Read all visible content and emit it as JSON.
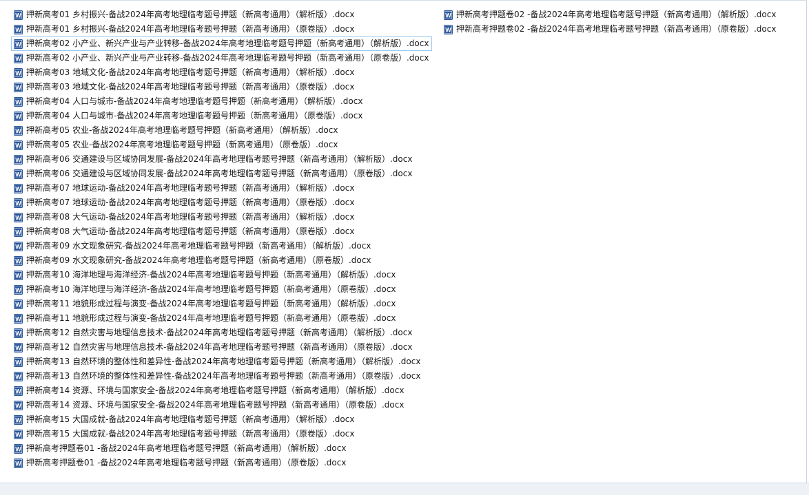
{
  "file_list": {
    "icon": "word-document-icon",
    "icon_color": "#2b579a",
    "selected_index": 2,
    "column_1": [
      "押新高考01 乡村振兴-备战2024年高考地理临考题号押题（新高考通用）（解析版）.docx",
      "押新高考01 乡村振兴-备战2024年高考地理临考题号押题（新高考通用）（原卷版）.docx",
      "押新高考02 小产业、新兴产业与产业转移-备战2024年高考地理临考题号押题（新高考通用）（解析版）.docx",
      "押新高考02 小产业、新兴产业与产业转移-备战2024年高考地理临考题号押题（新高考通用）（原卷版）.docx",
      "押新高考03 地域文化-备战2024年高考地理临考题号押题（新高考通用）（解析版）.docx",
      "押新高考03 地域文化-备战2024年高考地理临考题号押题（新高考通用）（原卷版）.docx",
      "押新高考04 人口与城市-备战2024年高考地理临考题号押题（新高考通用）（解析版）.docx",
      "押新高考04 人口与城市-备战2024年高考地理临考题号押题（新高考通用）（原卷版）.docx",
      "押新高考05 农业-备战2024年高考地理临考题号押题（新高考通用）（解析版）.docx",
      "押新高考05 农业-备战2024年高考地理临考题号押题（新高考通用）（原卷版）.docx",
      "押新高考06 交通建设与区域协同发展-备战2024年高考地理临考题号押题（新高考通用）（解析版）.docx",
      "押新高考06 交通建设与区域协同发展-备战2024年高考地理临考题号押题（新高考通用）（原卷版）.docx",
      "押新高考07 地球运动-备战2024年高考地理临考题号押题（新高考通用）（解析版）.docx",
      "押新高考07 地球运动-备战2024年高考地理临考题号押题（新高考通用）（原卷版）.docx",
      "押新高考08 大气运动-备战2024年高考地理临考题号押题（新高考通用）（解析版）.docx",
      "押新高考08 大气运动-备战2024年高考地理临考题号押题（新高考通用）（原卷版）.docx",
      "押新高考09 水文现象研究-备战2024年高考地理临考题号押题（新高考通用）（解析版）.docx",
      "押新高考09 水文现象研究-备战2024年高考地理临考题号押题（新高考通用）（原卷版）.docx",
      "押新高考10 海洋地理与海洋经济-备战2024年高考地理临考题号押题（新高考通用）（解析版）.docx",
      "押新高考10 海洋地理与海洋经济-备战2024年高考地理临考题号押题（新高考通用）（原卷版）.docx",
      "押新高考11 地貌形成过程与演变-备战2024年高考地理临考题号押题（新高考通用）（解析版）.docx",
      "押新高考11 地貌形成过程与演变-备战2024年高考地理临考题号押题（新高考通用）（原卷版）.docx",
      "押新高考12 自然灾害与地理信息技术-备战2024年高考地理临考题号押题（新高考通用）（解析版）.docx",
      "押新高考12 自然灾害与地理信息技术-备战2024年高考地理临考题号押题（新高考通用）（原卷版）.docx",
      "押新高考13 自然环境的整体性和差异性-备战2024年高考地理临考题号押题（新高考通用）（解析版）.docx",
      "押新高考13 自然环境的整体性和差异性-备战2024年高考地理临考题号押题（新高考通用）（原卷版）.docx",
      "押新高考14 资源、环境与国家安全-备战2024年高考地理临考题号押题（新高考通用）（解析版）.docx",
      "押新高考14 资源、环境与国家安全-备战2024年高考地理临考题号押题（新高考通用）（原卷版）.docx",
      "押新高考15 大国成就-备战2024年高考地理临考题号押题（新高考通用）（解析版）.docx",
      "押新高考15 大国成就-备战2024年高考地理临考题号押题（新高考通用）（原卷版）.docx",
      "押新高考押题卷01 -备战2024年高考地理临考题号押题（新高考通用）（解析版）.docx",
      "押新高考押题卷01 -备战2024年高考地理临考题号押题（新高考通用）（原卷版）.docx"
    ],
    "column_2": [
      "押新高考押题卷02 -备战2024年高考地理临考题号押题（新高考通用）（解析版）.docx",
      "押新高考押题卷02 -备战2024年高考地理临考题号押题（新高考通用）（原卷版）.docx"
    ]
  }
}
